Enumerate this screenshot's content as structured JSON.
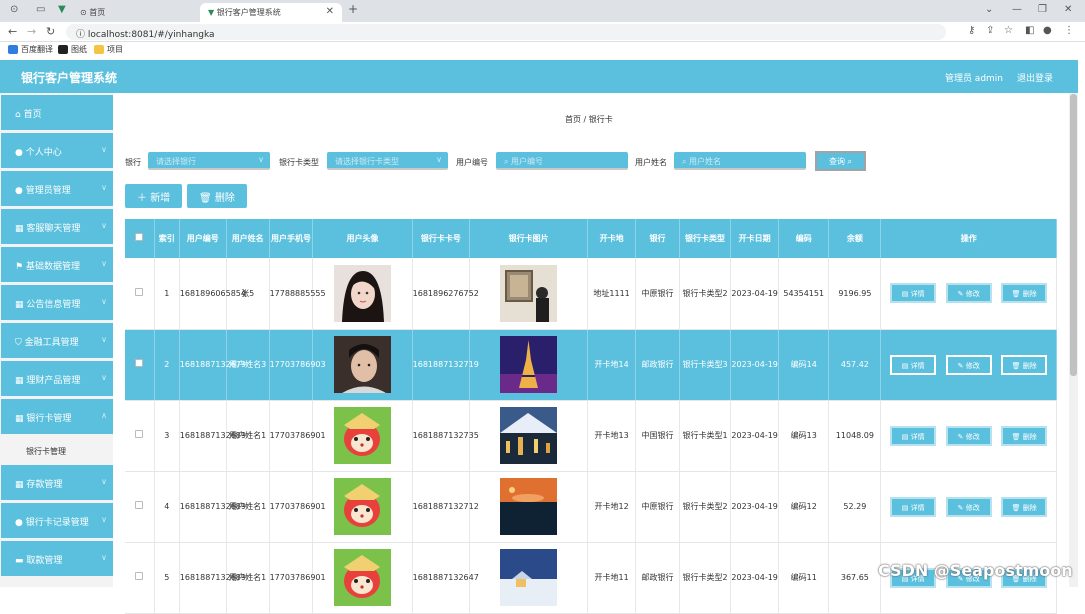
{
  "browser": {
    "tabs": [
      {
        "label": "首页"
      },
      {
        "label": "银行客户管理系统"
      }
    ],
    "url": "localhost:8081/#/yinhangka",
    "bookmarks": [
      "百度翻译",
      "图纸",
      "项目"
    ]
  },
  "header": {
    "title": "银行客户管理系统",
    "admin": "管理员 admin",
    "logout": "退出登录"
  },
  "sidebar": {
    "items": [
      {
        "label": "首页"
      },
      {
        "label": "个人中心"
      },
      {
        "label": "管理员管理"
      },
      {
        "label": "客服聊天管理"
      },
      {
        "label": "基础数据管理"
      },
      {
        "label": "公告信息管理"
      },
      {
        "label": "金融工具管理"
      },
      {
        "label": "理财产品管理"
      },
      {
        "label": "银行卡管理"
      },
      {
        "label": "存款管理"
      },
      {
        "label": "银行卡记录管理"
      },
      {
        "label": "取款管理"
      }
    ],
    "active_sub": "银行卡管理"
  },
  "breadcrumb": {
    "home": "首页",
    "sep": "/",
    "current": "银行卡"
  },
  "filters": {
    "bank_label": "银行",
    "bank_placeholder": "请选择银行",
    "type_label": "银行卡类型",
    "type_placeholder": "请选择银行卡类型",
    "user_no_label": "用户编号",
    "user_no_placeholder": "用户编号",
    "user_name_label": "用户姓名",
    "user_name_placeholder": "用户姓名",
    "query": "查询"
  },
  "actions": {
    "add": "新增",
    "delete": "删除"
  },
  "table": {
    "columns": [
      "索引",
      "用户编号",
      "用户姓名",
      "用户手机号",
      "用户头像",
      "银行卡卡号",
      "银行卡图片",
      "开卡地",
      "银行",
      "银行卡类型",
      "开卡日期",
      "编码",
      "余额",
      "操作"
    ],
    "rows": [
      {
        "idx": "1",
        "user_no": "1681896065854",
        "name": "张5",
        "phone": "17788885555",
        "card_no": "1681896276752",
        "place": "地址1111",
        "bank": "中原银行",
        "type": "银行卡类型2",
        "date": "2023-04-19",
        "code": "54354151",
        "balance": "9196.95"
      },
      {
        "idx": "2",
        "user_no": "1681887132679",
        "name": "用户姓名3",
        "phone": "17703786903",
        "card_no": "1681887132719",
        "place": "开卡地14",
        "bank": "邮政银行",
        "type": "银行卡类型3",
        "date": "2023-04-19",
        "code": "编码14",
        "balance": "457.42"
      },
      {
        "idx": "3",
        "user_no": "1681887132689",
        "name": "用户姓名1",
        "phone": "17703786901",
        "card_no": "1681887132735",
        "place": "开卡地13",
        "bank": "中国银行",
        "type": "银行卡类型1",
        "date": "2023-04-19",
        "code": "编码13",
        "balance": "11048.09"
      },
      {
        "idx": "4",
        "user_no": "1681887132689",
        "name": "用户姓名1",
        "phone": "17703786901",
        "card_no": "1681887132712",
        "place": "开卡地12",
        "bank": "中原银行",
        "type": "银行卡类型2",
        "date": "2023-04-19",
        "code": "编码12",
        "balance": "52.29"
      },
      {
        "idx": "5",
        "user_no": "1681887132689",
        "name": "用户姓名1",
        "phone": "17703786901",
        "card_no": "1681887132647",
        "place": "开卡地11",
        "bank": "邮政银行",
        "type": "银行卡类型2",
        "date": "2023-04-19",
        "code": "编码11",
        "balance": "367.65"
      }
    ],
    "ops": {
      "detail": "详情",
      "edit": "修改",
      "delete": "删除"
    }
  },
  "watermark": "CSDN @Seapostmoon",
  "colors": {
    "accent": "#5bc0de",
    "highlight_row": "#5bc0de"
  }
}
